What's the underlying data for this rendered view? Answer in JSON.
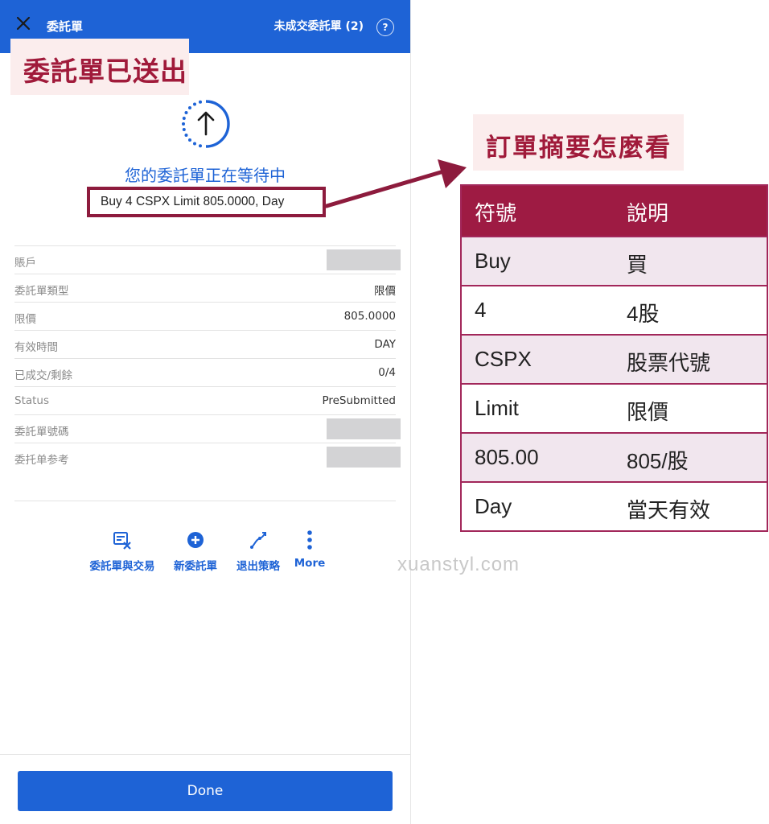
{
  "header": {
    "title": "委託單",
    "pending_orders": "未成交委託單 (2)",
    "help_symbol": "?"
  },
  "banner_sent": "委託單已送出",
  "status": {
    "waiting_text": "您的委託單正在等待中",
    "order_summary": "Buy 4 CSPX Limit 805.0000, Day"
  },
  "details": [
    {
      "label": "賬戶",
      "value": "",
      "masked": true
    },
    {
      "label": "委託單類型",
      "value": "限價",
      "masked": false
    },
    {
      "label": "限價",
      "value": "805.0000",
      "masked": false
    },
    {
      "label": "有效時間",
      "value": "DAY",
      "masked": false
    },
    {
      "label": "已成交/剩餘",
      "value": "0/4",
      "masked": false
    },
    {
      "label": "Status",
      "value": "PreSubmitted",
      "masked": false
    },
    {
      "label": "委託單號碼",
      "value": "",
      "masked": true
    },
    {
      "label": "委托单参考",
      "value": "",
      "masked": true
    }
  ],
  "actions": [
    {
      "label": "委託單與交易",
      "icon": "orders-trades-icon"
    },
    {
      "label": "新委託單",
      "icon": "plus-circle-icon"
    },
    {
      "label": "退出策略",
      "icon": "exit-strategy-icon"
    },
    {
      "label": "More",
      "icon": "more-vertical-icon"
    }
  ],
  "done_label": "Done",
  "annotation": {
    "banner": "訂單摘要怎麼看",
    "table": {
      "headers": [
        "符號",
        "說明"
      ],
      "rows": [
        [
          "Buy",
          "買"
        ],
        [
          "4",
          "4股"
        ],
        [
          "CSPX",
          "股票代號"
        ],
        [
          "Limit",
          "限價"
        ],
        [
          "805.00",
          "805/股"
        ],
        [
          "Day",
          "當天有效"
        ]
      ]
    }
  },
  "watermark": "xuanstyl.com",
  "colors": {
    "brand_blue": "#1e63d6",
    "annotation_red": "#9e1b43",
    "banner_pink": "#fbeded",
    "table_stripe": "#f1e6ee"
  }
}
